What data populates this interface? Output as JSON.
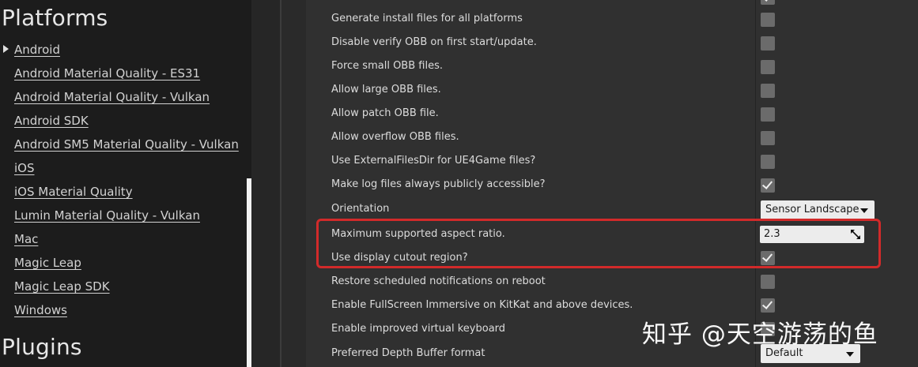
{
  "sidebar": {
    "title_platforms": "Platforms",
    "title_plugins": "Plugins",
    "items": [
      {
        "label": "Android",
        "expanded_arrow": true
      },
      {
        "label": "Android Material Quality - ES31"
      },
      {
        "label": "Android Material Quality - Vulkan"
      },
      {
        "label": "Android SDK"
      },
      {
        "label": "Android SM5 Material Quality - Vulkan"
      },
      {
        "label": "iOS"
      },
      {
        "label": "iOS Material Quality"
      },
      {
        "label": "Lumin Material Quality - Vulkan"
      },
      {
        "label": "Mac"
      },
      {
        "label": "Magic Leap"
      },
      {
        "label": "Magic Leap SDK"
      },
      {
        "label": "Windows"
      }
    ]
  },
  "settings": {
    "rows": [
      {
        "label": "Generate install files for all platforms",
        "control": "checkbox",
        "checked": false
      },
      {
        "label": "Disable verify OBB on first start/update.",
        "control": "checkbox",
        "checked": false
      },
      {
        "label": "Force small OBB files.",
        "control": "checkbox",
        "checked": false
      },
      {
        "label": "Allow large OBB files.",
        "control": "checkbox",
        "checked": false
      },
      {
        "label": "Allow patch OBB file.",
        "control": "checkbox",
        "checked": false
      },
      {
        "label": "Allow overflow OBB files.",
        "control": "checkbox",
        "checked": false
      },
      {
        "label": "Use ExternalFilesDir for UE4Game files?",
        "control": "checkbox",
        "checked": false
      },
      {
        "label": "Make log files always publicly accessible?",
        "control": "checkbox",
        "checked": true
      },
      {
        "label": "Orientation",
        "control": "dropdown",
        "value": "Sensor Landscape"
      },
      {
        "label": "Maximum supported aspect ratio.",
        "control": "number",
        "value": "2.3"
      },
      {
        "label": "Use display cutout region?",
        "control": "checkbox",
        "checked": true
      },
      {
        "label": "Restore scheduled notifications on reboot",
        "control": "checkbox",
        "checked": false
      },
      {
        "label": "Enable FullScreen Immersive on KitKat and above devices.",
        "control": "checkbox",
        "checked": true
      },
      {
        "label": "Enable improved virtual keyboard",
        "control": "checkbox",
        "checked": false
      },
      {
        "label": "Preferred Depth Buffer format",
        "control": "dropdown",
        "value": "Default"
      }
    ]
  },
  "watermark": {
    "text": "知乎 @天空游荡的鱼"
  },
  "colors": {
    "highlight": "#d22a2a",
    "panel": "#303030",
    "sidebar": "#1c1c1c"
  }
}
